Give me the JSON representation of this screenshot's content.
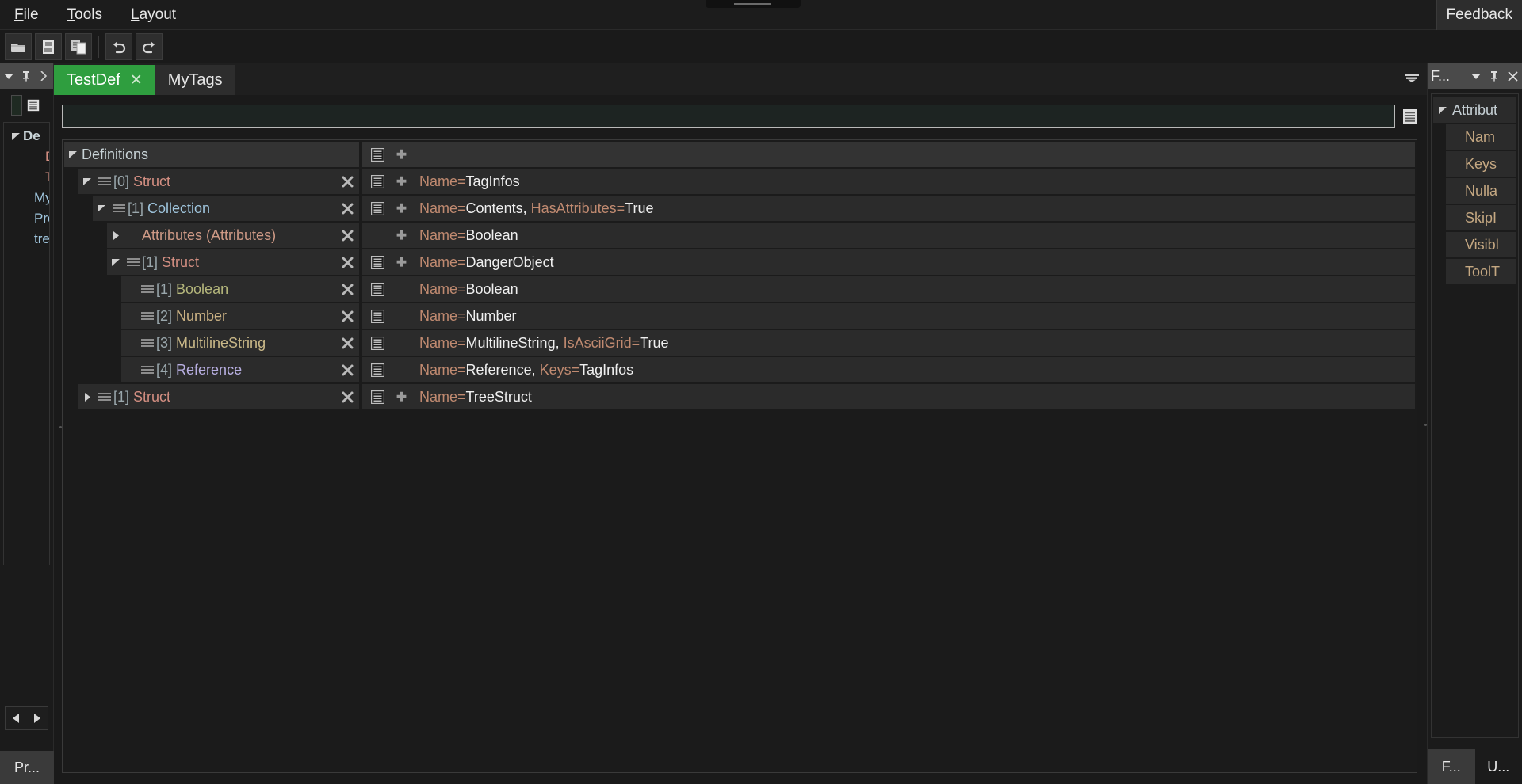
{
  "app": {
    "title_grip": "",
    "menu": [
      {
        "label": "File",
        "accel": "F"
      },
      {
        "label": "Tools",
        "accel": "T"
      },
      {
        "label": "Layout",
        "accel": "L"
      }
    ],
    "feedback_label": "Feedback",
    "accent_tab_color": "#2f9e3f"
  },
  "toolbar": {
    "buttons": [
      {
        "name": "open-icon",
        "title": "Open"
      },
      {
        "name": "save-icon",
        "title": "Save"
      },
      {
        "name": "save-as-icon",
        "title": "Save As"
      },
      {
        "name": "undo-icon",
        "title": "Undo"
      },
      {
        "name": "redo-icon",
        "title": "Redo"
      }
    ]
  },
  "left_dock": {
    "header_icons": [
      "chevron-down-icon",
      "pin-icon",
      "chevron-right-icon"
    ],
    "tree_rows": [
      {
        "label": "De",
        "type": "definitions",
        "expanded": true,
        "indent": 0
      },
      {
        "label": "D",
        "type": "struct",
        "expanded": false,
        "indent": 2
      },
      {
        "label": "T",
        "type": "struct",
        "expanded": false,
        "indent": 2
      },
      {
        "label": "My",
        "type": "collection",
        "expanded": false,
        "indent": 1
      },
      {
        "label": "Pro",
        "type": "collection",
        "expanded": false,
        "indent": 1
      },
      {
        "label": "tre",
        "type": "collection",
        "expanded": false,
        "indent": 1
      }
    ],
    "nav_prev": "◀",
    "nav_next": "▶",
    "tab_label": "Pr..."
  },
  "document_tabs": [
    {
      "label": "TestDef",
      "active": true,
      "closable": true,
      "close_glyph": "✕"
    },
    {
      "label": "MyTags",
      "active": false,
      "closable": false,
      "close_glyph": ""
    }
  ],
  "search": {
    "value": "",
    "placeholder": ""
  },
  "grid": {
    "header": {
      "left_label": "Definitions",
      "expanded": true,
      "right_icons": [
        "list-icon",
        "plus-icon"
      ],
      "right_text": []
    },
    "rows": [
      {
        "indent": 1,
        "expanded": true,
        "collapsible": true,
        "has_handle": true,
        "index": "[0]",
        "type_label": "Struct",
        "type_class": "t-struct",
        "show_list_icon": true,
        "show_plus_icon": true,
        "attrs": [
          {
            "key": "Name",
            "value": "TagInfos"
          }
        ]
      },
      {
        "indent": 2,
        "expanded": true,
        "collapsible": true,
        "has_handle": true,
        "index": "[1]",
        "type_label": "Collection",
        "type_class": "t-collection",
        "show_list_icon": true,
        "show_plus_icon": true,
        "attrs": [
          {
            "key": "Name",
            "value": "Contents"
          },
          {
            "key": "HasAttributes",
            "value": "True"
          }
        ]
      },
      {
        "indent": 3,
        "expanded": false,
        "collapsible": true,
        "has_handle": false,
        "index": "",
        "type_label": "Attributes (Attributes)",
        "type_class": "t-attributes",
        "show_list_icon": false,
        "show_plus_icon": true,
        "attrs": [
          {
            "key": "Name",
            "value": "Boolean"
          }
        ]
      },
      {
        "indent": 3,
        "expanded": true,
        "collapsible": true,
        "has_handle": true,
        "index": "[1]",
        "type_label": "Struct",
        "type_class": "t-struct",
        "show_list_icon": true,
        "show_plus_icon": true,
        "attrs": [
          {
            "key": "Name",
            "value": "DangerObject"
          }
        ]
      },
      {
        "indent": 4,
        "expanded": null,
        "collapsible": false,
        "has_handle": true,
        "index": "[1]",
        "type_label": "Boolean",
        "type_class": "t-boolean",
        "show_list_icon": true,
        "show_plus_icon": false,
        "attrs": [
          {
            "key": "Name",
            "value": "Boolean"
          }
        ]
      },
      {
        "indent": 4,
        "expanded": null,
        "collapsible": false,
        "has_handle": true,
        "index": "[2]",
        "type_label": "Number",
        "type_class": "t-number",
        "show_list_icon": true,
        "show_plus_icon": false,
        "attrs": [
          {
            "key": "Name",
            "value": "Number"
          }
        ]
      },
      {
        "indent": 4,
        "expanded": null,
        "collapsible": false,
        "has_handle": true,
        "index": "[3]",
        "type_label": "MultilineString",
        "type_class": "t-mlstring",
        "show_list_icon": true,
        "show_plus_icon": false,
        "attrs": [
          {
            "key": "Name",
            "value": "MultilineString"
          },
          {
            "key": "IsAsciiGrid",
            "value": "True"
          }
        ]
      },
      {
        "indent": 4,
        "expanded": null,
        "collapsible": false,
        "has_handle": true,
        "index": "[4]",
        "type_label": "Reference",
        "type_class": "t-reference",
        "show_list_icon": true,
        "show_plus_icon": false,
        "attrs": [
          {
            "key": "Name",
            "value": "Reference"
          },
          {
            "key": "Keys",
            "value": "TagInfos"
          }
        ]
      },
      {
        "indent": 1,
        "expanded": false,
        "collapsible": true,
        "has_handle": true,
        "index": "[1]",
        "type_label": "Struct",
        "type_class": "t-struct",
        "show_list_icon": true,
        "show_plus_icon": true,
        "attrs": [
          {
            "key": "Name",
            "value": "TreeStruct"
          }
        ]
      }
    ]
  },
  "right_dock": {
    "title": "F...",
    "header_icons": [
      "chevron-down-icon",
      "pin-icon",
      "close-icon"
    ],
    "tree_rows": [
      {
        "label": "Attribut",
        "indent": 0,
        "expanded": true,
        "root": true
      },
      {
        "label": "Nam",
        "indent": 1,
        "expanded": null,
        "root": false
      },
      {
        "label": "Keys",
        "indent": 1,
        "expanded": null,
        "root": false
      },
      {
        "label": "Nulla",
        "indent": 1,
        "expanded": null,
        "root": false
      },
      {
        "label": "SkipI",
        "indent": 1,
        "expanded": null,
        "root": false
      },
      {
        "label": "Visibl",
        "indent": 1,
        "expanded": null,
        "root": false
      },
      {
        "label": "ToolT",
        "indent": 1,
        "expanded": null,
        "root": false
      }
    ],
    "tabs": [
      {
        "label": "F...",
        "active": true
      },
      {
        "label": "U...",
        "active": false
      }
    ]
  }
}
